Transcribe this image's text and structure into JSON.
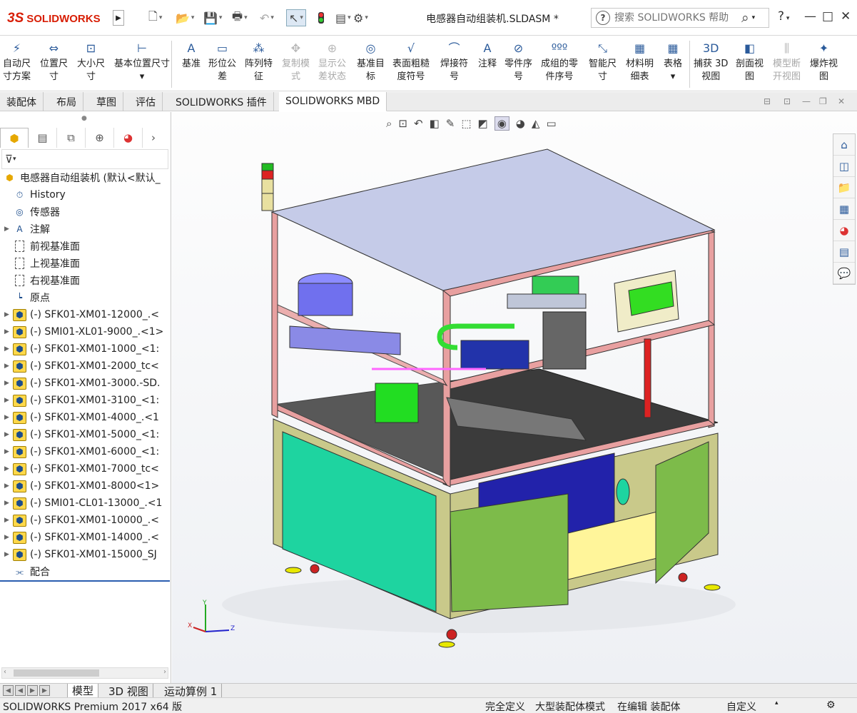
{
  "app": {
    "logo_text": "SOLIDWORKS",
    "logo_mark": "3S",
    "doc_title": "电感器自动组装机.SLDASM *",
    "search_placeholder": "搜索 SOLIDWORKS 帮助"
  },
  "quick_access": {
    "new_icon": "new-document-icon",
    "open_icon": "open-folder-icon",
    "save_icon": "save-icon",
    "print_icon": "print-icon",
    "undo_icon": "undo-icon",
    "select_icon": "select-pointer-icon",
    "rebuild_icon": "traffic-light-icon",
    "file_props_icon": "file-properties-icon",
    "options_icon": "gear-icon"
  },
  "window_controls": {
    "help": "?",
    "minimize": "—",
    "maximize": "□",
    "close": "✕"
  },
  "command_manager": {
    "items": [
      {
        "label_l1": "自动尺",
        "label_l2": "寸方案",
        "icon": "⚡",
        "disabled": false
      },
      {
        "label_l1": "位置尺",
        "label_l2": "寸",
        "icon": "⇔",
        "disabled": false
      },
      {
        "label_l1": "大小尺",
        "label_l2": "寸",
        "icon": "⊡",
        "disabled": false
      },
      {
        "label_l1": "基本位置尺寸",
        "label_l2": "▾",
        "icon": "⊢",
        "disabled": false
      },
      {
        "label_l1": "基准",
        "label_l2": "",
        "icon": "A",
        "disabled": false
      },
      {
        "label_l1": "形位公",
        "label_l2": "差",
        "icon": "▭",
        "disabled": false
      },
      {
        "label_l1": "阵列特",
        "label_l2": "征",
        "icon": "⁂",
        "disabled": false
      },
      {
        "label_l1": "复制模",
        "label_l2": "式",
        "icon": "✥",
        "disabled": true
      },
      {
        "label_l1": "显示公",
        "label_l2": "差状态",
        "icon": "⊕",
        "disabled": true
      },
      {
        "label_l1": "基准目",
        "label_l2": "标",
        "icon": "◎",
        "disabled": false
      },
      {
        "label_l1": "表面粗糙",
        "label_l2": "度符号",
        "icon": "√",
        "disabled": false
      },
      {
        "label_l1": "焊接符",
        "label_l2": "号",
        "icon": "⌒",
        "disabled": false
      },
      {
        "label_l1": "注释",
        "label_l2": "",
        "icon": "A",
        "disabled": false
      },
      {
        "label_l1": "零件序",
        "label_l2": "号",
        "icon": "⊘",
        "disabled": false
      },
      {
        "label_l1": "成组的零",
        "label_l2": "件序号",
        "icon": "ººº",
        "disabled": false
      },
      {
        "label_l1": "智能尺",
        "label_l2": "寸",
        "icon": "⤡",
        "disabled": false
      },
      {
        "label_l1": "材料明",
        "label_l2": "细表",
        "icon": "▦",
        "disabled": false
      },
      {
        "label_l1": "表格",
        "label_l2": "▾",
        "icon": "▦",
        "disabled": false
      },
      {
        "label_l1": "捕获 3D",
        "label_l2": "视图",
        "icon": "3D",
        "disabled": false
      },
      {
        "label_l1": "剖面视",
        "label_l2": "图",
        "icon": "◧",
        "disabled": false
      },
      {
        "label_l1": "模型断",
        "label_l2": "开视图",
        "icon": "⫼",
        "disabled": true
      },
      {
        "label_l1": "爆炸视",
        "label_l2": "图",
        "icon": "✦",
        "disabled": false
      }
    ]
  },
  "tabs": [
    "装配体",
    "布局",
    "草图",
    "评估",
    "SOLIDWORKS 插件",
    "SOLIDWORKS MBD"
  ],
  "active_tab": "SOLIDWORKS MBD",
  "panel_tabs": [
    "feature-manager-icon",
    "property-manager-icon",
    "configuration-manager-icon",
    "dimxpert-icon",
    "display-manager-icon"
  ],
  "tree": {
    "root": "电感器自动组装机  (默认<默认_",
    "items": [
      {
        "label": "History",
        "type": "history",
        "expandable": false
      },
      {
        "label": "传感器",
        "type": "sensor",
        "expandable": false
      },
      {
        "label": "注解",
        "type": "annotation",
        "expandable": true
      },
      {
        "label": "前视基准面",
        "type": "plane",
        "expandable": false
      },
      {
        "label": "上视基准面",
        "type": "plane",
        "expandable": false
      },
      {
        "label": "右视基准面",
        "type": "plane",
        "expandable": false
      },
      {
        "label": "原点",
        "type": "origin",
        "expandable": false
      },
      {
        "label": "(-) SFK01-XM01-12000_.<",
        "type": "part",
        "expandable": true
      },
      {
        "label": "(-) SMI01-XL01-9000_.<1>",
        "type": "part",
        "expandable": true
      },
      {
        "label": "(-) SFK01-XM01-1000_<1:",
        "type": "part",
        "expandable": true
      },
      {
        "label": "(-) SFK01-XM01-2000_tc<",
        "type": "part",
        "expandable": true
      },
      {
        "label": "(-) SFK01-XM01-3000.-SD.",
        "type": "part",
        "expandable": true
      },
      {
        "label": "(-) SFK01-XM01-3100_<1:",
        "type": "part",
        "expandable": true
      },
      {
        "label": "(-) SFK01-XM01-4000_.<1",
        "type": "part",
        "expandable": true
      },
      {
        "label": "(-) SFK01-XM01-5000_<1:",
        "type": "part",
        "expandable": true
      },
      {
        "label": "(-) SFK01-XM01-6000_<1:",
        "type": "part",
        "expandable": true
      },
      {
        "label": "(-) SFK01-XM01-7000_tc<",
        "type": "part",
        "expandable": true
      },
      {
        "label": "(-) SFK01-XM01-8000<1>",
        "type": "part",
        "expandable": true
      },
      {
        "label": "(-) SMI01-CL01-13000_.<1",
        "type": "part",
        "expandable": true
      },
      {
        "label": "(-) SFK01-XM01-10000_.<",
        "type": "part",
        "expandable": true
      },
      {
        "label": "(-) SFK01-XM01-14000_.<",
        "type": "part",
        "expandable": true
      },
      {
        "label": "(-) SFK01-XM01-15000_SJ",
        "type": "part",
        "expandable": true
      },
      {
        "label": "配合",
        "type": "mates",
        "expandable": false
      }
    ]
  },
  "axes": {
    "x": "X",
    "y": "Y",
    "z": "Z"
  },
  "bottom_tabs": [
    "模型",
    "3D 视图",
    "运动算例 1"
  ],
  "active_bottom_tab": "模型",
  "status": {
    "version": "SOLIDWORKS Premium 2017 x64 版",
    "definition": "完全定义",
    "mode": "大型装配体模式",
    "editing": "在编辑 装配体",
    "units": "自定义"
  }
}
